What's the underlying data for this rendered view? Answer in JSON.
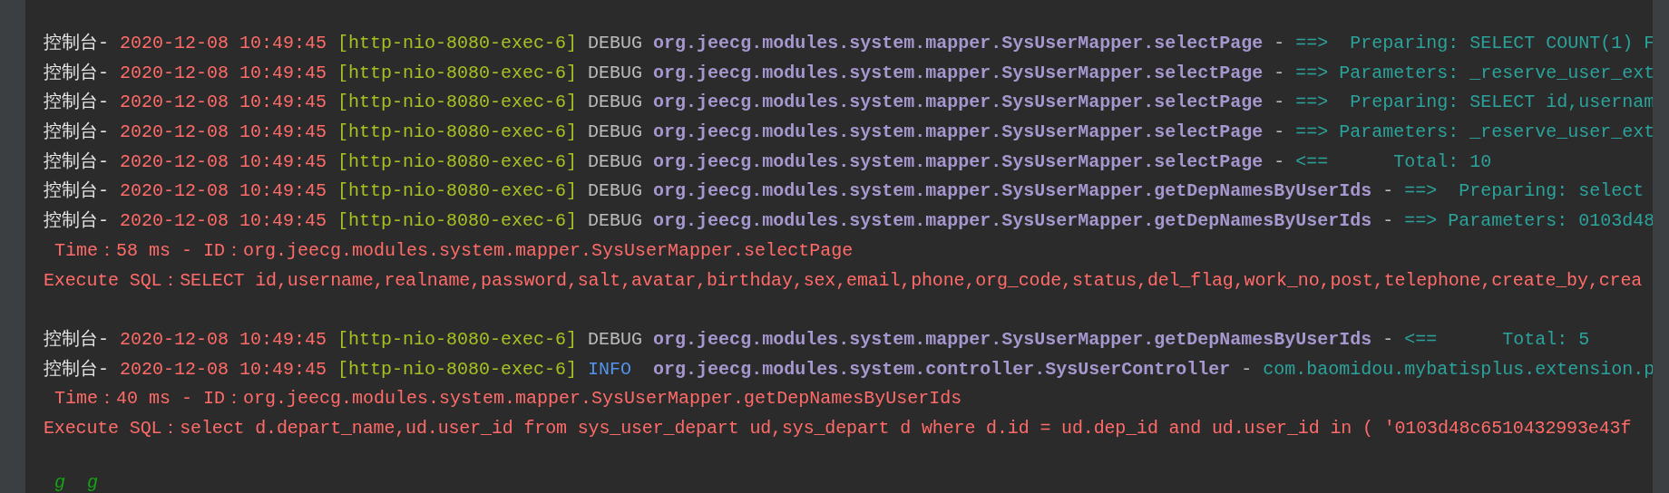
{
  "console": {
    "lines": [
      {
        "kind": "log",
        "segments": [
          {
            "kind": "prefix",
            "text": "控制台-"
          },
          {
            "kind": "time",
            "text": "2020-12-08 10:49:45"
          },
          {
            "kind": "thread",
            "text": "[http-nio-8080-exec-6]"
          },
          {
            "kind": "debug",
            "text": "DEBUG"
          },
          {
            "kind": "logger",
            "text": "org.jeecg.modules.system.mapper.SysUserMapper.selectPage"
          },
          {
            "kind": "dash",
            "text": "-"
          },
          {
            "kind": "message",
            "text": "==>  Preparing: SELECT COUNT(1) F"
          }
        ]
      },
      {
        "kind": "log",
        "segments": [
          {
            "kind": "prefix",
            "text": "控制台-"
          },
          {
            "kind": "time",
            "text": "2020-12-08 10:49:45"
          },
          {
            "kind": "thread",
            "text": "[http-nio-8080-exec-6]"
          },
          {
            "kind": "debug",
            "text": "DEBUG"
          },
          {
            "kind": "logger",
            "text": "org.jeecg.modules.system.mapper.SysUserMapper.selectPage"
          },
          {
            "kind": "dash",
            "text": "-"
          },
          {
            "kind": "message",
            "text": "==> Parameters: _reserve_user_ext"
          }
        ]
      },
      {
        "kind": "log",
        "segments": [
          {
            "kind": "prefix",
            "text": "控制台-"
          },
          {
            "kind": "time",
            "text": "2020-12-08 10:49:45"
          },
          {
            "kind": "thread",
            "text": "[http-nio-8080-exec-6]"
          },
          {
            "kind": "debug",
            "text": "DEBUG"
          },
          {
            "kind": "logger",
            "text": "org.jeecg.modules.system.mapper.SysUserMapper.selectPage"
          },
          {
            "kind": "dash",
            "text": "-"
          },
          {
            "kind": "message",
            "text": "==>  Preparing: SELECT id,usernam"
          }
        ]
      },
      {
        "kind": "log",
        "segments": [
          {
            "kind": "prefix",
            "text": "控制台-"
          },
          {
            "kind": "time",
            "text": "2020-12-08 10:49:45"
          },
          {
            "kind": "thread",
            "text": "[http-nio-8080-exec-6]"
          },
          {
            "kind": "debug",
            "text": "DEBUG"
          },
          {
            "kind": "logger",
            "text": "org.jeecg.modules.system.mapper.SysUserMapper.selectPage"
          },
          {
            "kind": "dash",
            "text": "-"
          },
          {
            "kind": "message",
            "text": "==> Parameters: _reserve_user_ext"
          }
        ]
      },
      {
        "kind": "log",
        "segments": [
          {
            "kind": "prefix",
            "text": "控制台-"
          },
          {
            "kind": "time",
            "text": "2020-12-08 10:49:45"
          },
          {
            "kind": "thread",
            "text": "[http-nio-8080-exec-6]"
          },
          {
            "kind": "debug",
            "text": "DEBUG"
          },
          {
            "kind": "logger",
            "text": "org.jeecg.modules.system.mapper.SysUserMapper.selectPage"
          },
          {
            "kind": "dash",
            "text": "-"
          },
          {
            "kind": "message",
            "text": "<==      Total: 10"
          }
        ]
      },
      {
        "kind": "log",
        "segments": [
          {
            "kind": "prefix",
            "text": "控制台-"
          },
          {
            "kind": "time",
            "text": "2020-12-08 10:49:45"
          },
          {
            "kind": "thread",
            "text": "[http-nio-8080-exec-6]"
          },
          {
            "kind": "debug",
            "text": "DEBUG"
          },
          {
            "kind": "logger",
            "text": "org.jeecg.modules.system.mapper.SysUserMapper.getDepNamesByUserIds"
          },
          {
            "kind": "dash",
            "text": "-"
          },
          {
            "kind": "message",
            "text": "==>  Preparing: select"
          }
        ]
      },
      {
        "kind": "log",
        "segments": [
          {
            "kind": "prefix",
            "text": "控制台-"
          },
          {
            "kind": "time",
            "text": "2020-12-08 10:49:45"
          },
          {
            "kind": "thread",
            "text": "[http-nio-8080-exec-6]"
          },
          {
            "kind": "debug",
            "text": "DEBUG"
          },
          {
            "kind": "logger",
            "text": "org.jeecg.modules.system.mapper.SysUserMapper.getDepNamesByUserIds"
          },
          {
            "kind": "dash",
            "text": "-"
          },
          {
            "kind": "message",
            "text": "==> Parameters: 0103d48"
          }
        ]
      },
      {
        "kind": "sql",
        "segments": [
          {
            "kind": "timing",
            "text": " Time：58 ms - ID：org.jeecg.modules.system.mapper.SysUserMapper.selectPage"
          }
        ]
      },
      {
        "kind": "sql",
        "segments": [
          {
            "kind": "statement",
            "text": "Execute SQL：SELECT id,username,realname,password,salt,avatar,birthday,sex,email,phone,org_code,status,del_flag,work_no,post,telephone,create_by,crea"
          }
        ]
      },
      {
        "kind": "blank"
      },
      {
        "kind": "log",
        "segments": [
          {
            "kind": "prefix",
            "text": "控制台-"
          },
          {
            "kind": "time",
            "text": "2020-12-08 10:49:45"
          },
          {
            "kind": "thread",
            "text": "[http-nio-8080-exec-6]"
          },
          {
            "kind": "debug",
            "text": "DEBUG"
          },
          {
            "kind": "logger",
            "text": "org.jeecg.modules.system.mapper.SysUserMapper.getDepNamesByUserIds"
          },
          {
            "kind": "dash",
            "text": "-"
          },
          {
            "kind": "message",
            "text": "<==      Total: 5"
          }
        ]
      },
      {
        "kind": "log",
        "segments": [
          {
            "kind": "prefix",
            "text": "控制台-"
          },
          {
            "kind": "time",
            "text": "2020-12-08 10:49:45"
          },
          {
            "kind": "thread",
            "text": "[http-nio-8080-exec-6]"
          },
          {
            "kind": "info",
            "text": "INFO"
          },
          {
            "kind": "logger",
            "text": "org.jeecg.modules.system.controller.SysUserController"
          },
          {
            "kind": "dash",
            "text": "-"
          },
          {
            "kind": "message",
            "text": "com.baomidou.mybatisplus.extension.p"
          }
        ]
      },
      {
        "kind": "sql",
        "segments": [
          {
            "kind": "timing",
            "text": " Time：40 ms - ID：org.jeecg.modules.system.mapper.SysUserMapper.getDepNamesByUserIds"
          }
        ]
      },
      {
        "kind": "sql",
        "segments": [
          {
            "kind": "statement",
            "text": "Execute SQL：select d.depart_name,ud.user_id from sys_user_depart ud,sys_depart d where d.id = ud.dep_id and ud.user_id in ( '0103d48c6510432993e43f"
          }
        ]
      },
      {
        "kind": "blank"
      },
      {
        "kind": "output",
        "segments": [
          {
            "kind": "output",
            "text": " g  g"
          }
        ]
      }
    ]
  }
}
